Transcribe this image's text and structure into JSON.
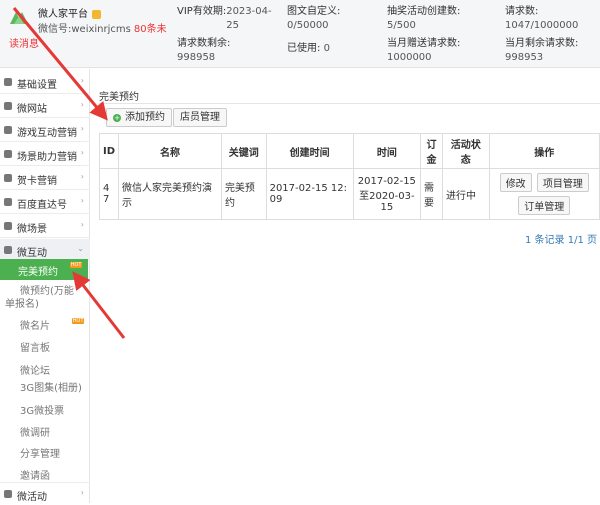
{
  "brand": {
    "name": "微人家平台",
    "account": "微信号:weixinrjcms",
    "count": "80条未",
    "unread": "读消息"
  },
  "stats": [
    {
      "label": "VIP有效期:",
      "value": "2023-04-25"
    },
    {
      "label": "请求数剩余:",
      "value": "998958"
    },
    {
      "label": "图文自定义:",
      "value": "0/50000"
    },
    {
      "label": "已使用:",
      "value": "0"
    },
    {
      "label": "抽奖活动创建数:",
      "value": "5/500"
    },
    {
      "label": "当月赠送请求数:",
      "value": "1000000"
    },
    {
      "label": "请求数:",
      "value": "1047/1000000"
    },
    {
      "label": "当月剩余请求数:",
      "value": "998953"
    }
  ],
  "sidebar": {
    "items": [
      {
        "label": "基础设置",
        "icon": "settings-icon"
      },
      {
        "label": "微网站",
        "icon": "site-icon"
      },
      {
        "label": "游戏互动营销",
        "icon": "game-icon"
      },
      {
        "label": "场景助力营销",
        "icon": "scene-icon"
      },
      {
        "label": "贺卡营销",
        "icon": "card-icon"
      },
      {
        "label": "百度直达号",
        "icon": "baidu-icon"
      },
      {
        "label": "微场景",
        "icon": "scene-icon"
      },
      {
        "label": "微互动",
        "icon": "interact-icon"
      }
    ],
    "active_sub": "完美预约",
    "sub_items": [
      "微预约(万能",
      "单报名)",
      "微名片",
      "留言板",
      "微论坛",
      "3G图集(相册)",
      "3G微投票",
      "微调研",
      "分享管理",
      "邀请函"
    ],
    "last_item": "微活动",
    "hot_badge": "HOT"
  },
  "main": {
    "title": "完美预约",
    "add_button": "添加预约",
    "store_button": "店员管理",
    "table": {
      "headers": [
        "ID",
        "名称",
        "关键词",
        "创建时间",
        "时间",
        "订金",
        "活动状态",
        "操作"
      ],
      "rows": [
        {
          "id": "47",
          "name": "微信人家完美预约演示",
          "keyword": "完美预约",
          "created": "2017-02-15 12:09",
          "time": "2017-02-15至2020-03-15",
          "deposit": "需要",
          "status": "进行中",
          "actions": [
            "修改",
            "项目管理",
            "订单管理"
          ]
        }
      ]
    },
    "pager": "1 条记录 1/1 页"
  },
  "colors": {
    "accent": "#4caf50",
    "alert": "#e33333",
    "link": "#337ab7",
    "arrow": "#e53935"
  }
}
